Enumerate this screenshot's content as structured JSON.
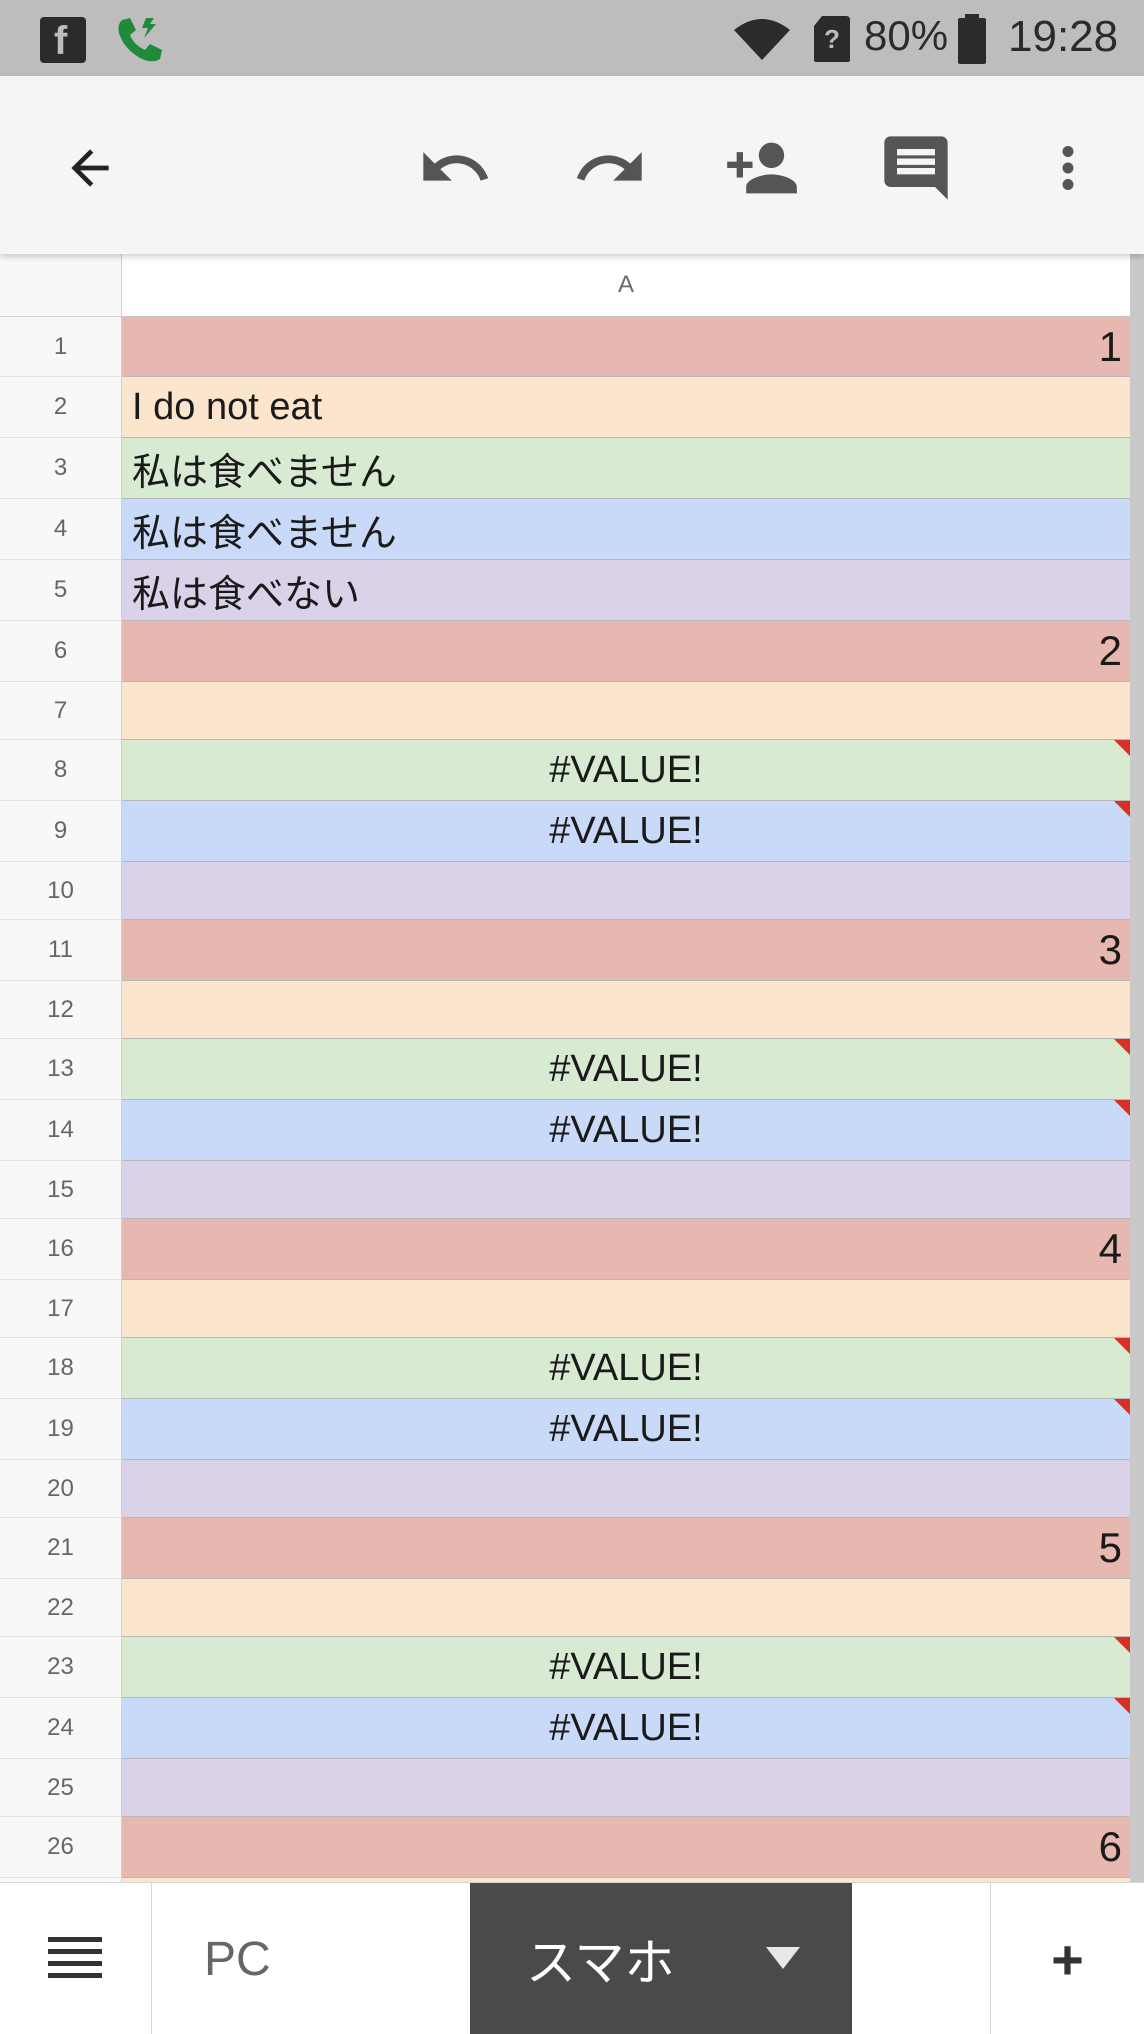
{
  "status_bar": {
    "facebook_icon": "facebook-icon",
    "phone_icon": "phone-call-icon",
    "wifi_icon": "wifi-icon",
    "sim_icon": "no-sim-icon",
    "battery_percent": "80%",
    "battery_level": 0.8,
    "time": "19:28"
  },
  "toolbar": {
    "back_icon": "arrow-back-icon",
    "undo_icon": "undo-icon",
    "redo_icon": "redo-icon",
    "share_icon": "person-add-icon",
    "comment_icon": "comment-icon",
    "more_icon": "more-vert-icon"
  },
  "sheet": {
    "column_header": "A",
    "rows": [
      {
        "num": "1",
        "value": "1",
        "color": "red",
        "align": "right",
        "error": false
      },
      {
        "num": "2",
        "value": "I do not eat",
        "color": "orange",
        "align": "left",
        "error": false
      },
      {
        "num": "3",
        "value": "私は食べません",
        "color": "green",
        "align": "left",
        "error": false
      },
      {
        "num": "4",
        "value": "私は食べません",
        "color": "blue",
        "align": "left",
        "error": false
      },
      {
        "num": "5",
        "value": "私は食べない",
        "color": "purple",
        "align": "left",
        "error": false
      },
      {
        "num": "6",
        "value": "2",
        "color": "red",
        "align": "right",
        "error": false
      },
      {
        "num": "7",
        "value": "",
        "color": "orange",
        "align": "left",
        "error": false
      },
      {
        "num": "8",
        "value": "#VALUE!",
        "color": "green",
        "align": "center",
        "error": true
      },
      {
        "num": "9",
        "value": "#VALUE!",
        "color": "blue",
        "align": "center",
        "error": true
      },
      {
        "num": "10",
        "value": "",
        "color": "purple",
        "align": "left",
        "error": false
      },
      {
        "num": "11",
        "value": "3",
        "color": "red",
        "align": "right",
        "error": false
      },
      {
        "num": "12",
        "value": "",
        "color": "orange",
        "align": "left",
        "error": false
      },
      {
        "num": "13",
        "value": "#VALUE!",
        "color": "green",
        "align": "center",
        "error": true
      },
      {
        "num": "14",
        "value": "#VALUE!",
        "color": "blue",
        "align": "center",
        "error": true
      },
      {
        "num": "15",
        "value": "",
        "color": "purple",
        "align": "left",
        "error": false
      },
      {
        "num": "16",
        "value": "4",
        "color": "red",
        "align": "right",
        "error": false
      },
      {
        "num": "17",
        "value": "",
        "color": "orange",
        "align": "left",
        "error": false
      },
      {
        "num": "18",
        "value": "#VALUE!",
        "color": "green",
        "align": "center",
        "error": true
      },
      {
        "num": "19",
        "value": "#VALUE!",
        "color": "blue",
        "align": "center",
        "error": true
      },
      {
        "num": "20",
        "value": "",
        "color": "purple",
        "align": "left",
        "error": false
      },
      {
        "num": "21",
        "value": "5",
        "color": "red",
        "align": "right",
        "error": false
      },
      {
        "num": "22",
        "value": "",
        "color": "orange",
        "align": "left",
        "error": false
      },
      {
        "num": "23",
        "value": "#VALUE!",
        "color": "green",
        "align": "center",
        "error": true
      },
      {
        "num": "24",
        "value": "#VALUE!",
        "color": "blue",
        "align": "center",
        "error": true
      },
      {
        "num": "25",
        "value": "",
        "color": "purple",
        "align": "left",
        "error": false
      },
      {
        "num": "26",
        "value": "6",
        "color": "red",
        "align": "right",
        "error": false
      },
      {
        "num": "",
        "value": "",
        "color": "orange",
        "align": "left",
        "error": false
      }
    ]
  },
  "tabs": {
    "menu_icon": "menu-icon",
    "items": [
      {
        "label": "PC",
        "active": false
      },
      {
        "label": "スマホ",
        "active": true
      }
    ],
    "add_icon": "add-icon",
    "add_label": "+"
  },
  "colors": {
    "red": "#e6b8af",
    "orange": "#fce5cd",
    "green": "#d9ead3",
    "blue": "#c9daf8",
    "purple": "#d9d2e9",
    "error_flag": "#d93025",
    "active_tab": "#4a4a4a"
  }
}
